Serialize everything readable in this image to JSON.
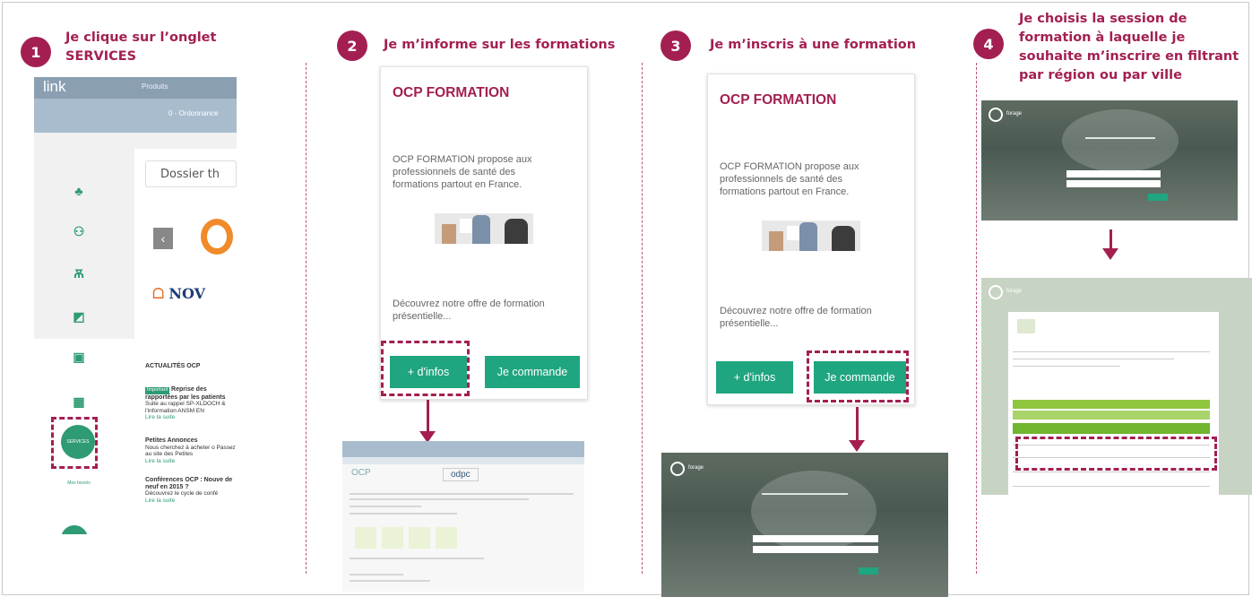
{
  "steps": [
    {
      "num": "1",
      "title_line1": "Je clique sur l’onglet",
      "title_line2": "SERVICES"
    },
    {
      "num": "2",
      "title": "Je m’informe sur les formations"
    },
    {
      "num": "3",
      "title": "Je m’inscris à une formation"
    },
    {
      "num": "4",
      "title_lines": [
        "Je choisis la session de",
        "formation à laquelle je",
        "souhaite m’inscrire en filtrant",
        "par région ou par ville"
      ]
    }
  ],
  "step1_screen": {
    "logo": "link",
    "product_label": "Produits",
    "band_text": "0 - Ordonnance",
    "search_text": "Dossier th",
    "prev_arrow": "‹",
    "brand": "NOV",
    "news_title": "ACTUALITÉS OCP",
    "news_items": [
      {
        "tag": "Important",
        "bold": "Reprise des rapportées par les patients",
        "text": "Suite au rappel SP-XLDOCH & l'information ANSM EN",
        "link": "Lire la suite"
      },
      {
        "bold": "Petites Annonces",
        "text": "Nous cherchez à acheter o Passez au site des Petites",
        "link": "Lire la suite"
      },
      {
        "bold": "Conférences OCP : Nouve de neuf en 2015 ?",
        "text": "Découvrez le cycle de confé",
        "link": "Lire la suite"
      }
    ],
    "services_label": "SERVICES",
    "mes_favoris": "Mes favoris",
    "plus_label": "+"
  },
  "card": {
    "title": "OCP FORMATION",
    "description": "OCP FORMATION propose aux professionnels de santé des formations partout en France.",
    "offer": "Découvrez notre offre de formation présentielle...",
    "info_button": "+ d'infos",
    "order_button": "Je commande"
  },
  "step2_screen": {
    "logo_left": "OCP",
    "logo_right": "odpc"
  },
  "step3_screen": {
    "logo_text": "forage"
  },
  "step4_screen": {
    "logo_text": "forage"
  }
}
